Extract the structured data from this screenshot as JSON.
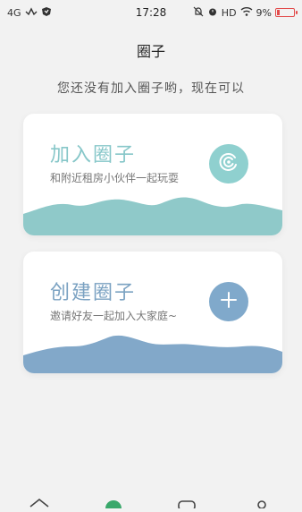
{
  "status_bar": {
    "network": "4G",
    "time": "17:28",
    "hd": "HD",
    "battery_percent": "9%",
    "battery_color": "#e24b4b"
  },
  "header": {
    "title": "圈子",
    "subtitle": "您还没有加入圈子哟，现在可以"
  },
  "cards": {
    "join": {
      "title": "加入圈子",
      "description": "和附近租房小伙伴一起玩耍",
      "button_icon": "target-icon",
      "color": "#8fd0cf"
    },
    "create": {
      "title": "创建圈子",
      "description": "邀请好友一起加入大家庭~",
      "button_icon": "plus-icon",
      "color": "#80a9cb"
    }
  },
  "bottom_nav": {
    "icons": [
      "home-icon",
      "circle-icon",
      "message-icon",
      "profile-icon"
    ]
  }
}
